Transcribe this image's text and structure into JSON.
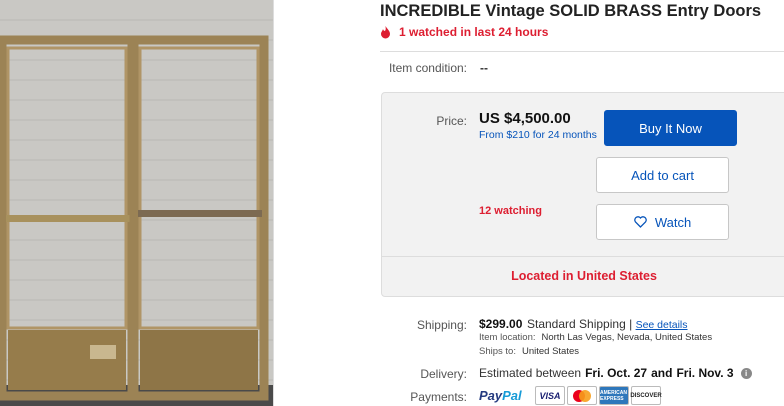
{
  "listing": {
    "title": "INCREDIBLE Vintage SOLID BRASS Entry Doors",
    "watched_alert": "1 watched in last 24 hours",
    "condition_label": "Item condition:",
    "condition_value": "--"
  },
  "purchase": {
    "price_label": "Price:",
    "price": "US $4,500.00",
    "financing": "From $210 for 24 months",
    "buy_now_label": "Buy It Now",
    "add_to_cart_label": "Add to cart",
    "watch_label": "Watch",
    "watching_count": "12 watching",
    "located": "Located in United States"
  },
  "shipping": {
    "label": "Shipping:",
    "price": "$299.00",
    "method": "Standard Shipping",
    "separator": "|",
    "see_details": "See details",
    "location_label": "Item location:",
    "location_value": "North Las Vegas, Nevada, United States",
    "ships_to_label": "Ships to:",
    "ships_to_value": "United States"
  },
  "delivery": {
    "label": "Delivery:",
    "prefix": "Estimated between",
    "date1": "Fri. Oct. 27",
    "and": "and",
    "date2": "Fri. Nov. 3",
    "info_icon": "i"
  },
  "payments": {
    "label": "Payments:",
    "paypal_1": "Pay",
    "paypal_2": "Pal",
    "cards": [
      "VISA",
      "AMERICAN EXPRESS",
      "DISCOVER"
    ]
  },
  "icons": [
    "flame-icon",
    "heart-icon",
    "info-icon",
    "mastercard-icon"
  ],
  "colors": {
    "accent_blue": "#0654ba",
    "alert_red": "#dd1e31",
    "box_gray": "#f2f2f2"
  }
}
